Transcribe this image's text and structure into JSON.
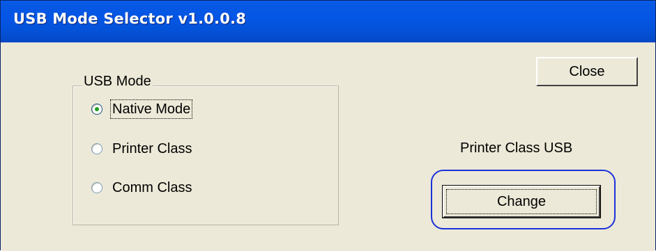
{
  "window": {
    "title": "USB Mode Selector v1.0.0.8"
  },
  "usb_mode_group": {
    "legend": "USB Mode",
    "options": [
      {
        "label": "Native Mode",
        "selected": true
      },
      {
        "label": "Printer Class",
        "selected": false
      },
      {
        "label": "Comm Class",
        "selected": false
      }
    ]
  },
  "buttons": {
    "close_label": "Close",
    "change_label": "Change"
  },
  "status": {
    "current_mode_text": "Printer Class USB"
  },
  "colors": {
    "titlebar": "#0456e6",
    "window_background": "#ece9d8",
    "highlight_ring": "#1a31d8",
    "radio_dot": "#21a121"
  }
}
